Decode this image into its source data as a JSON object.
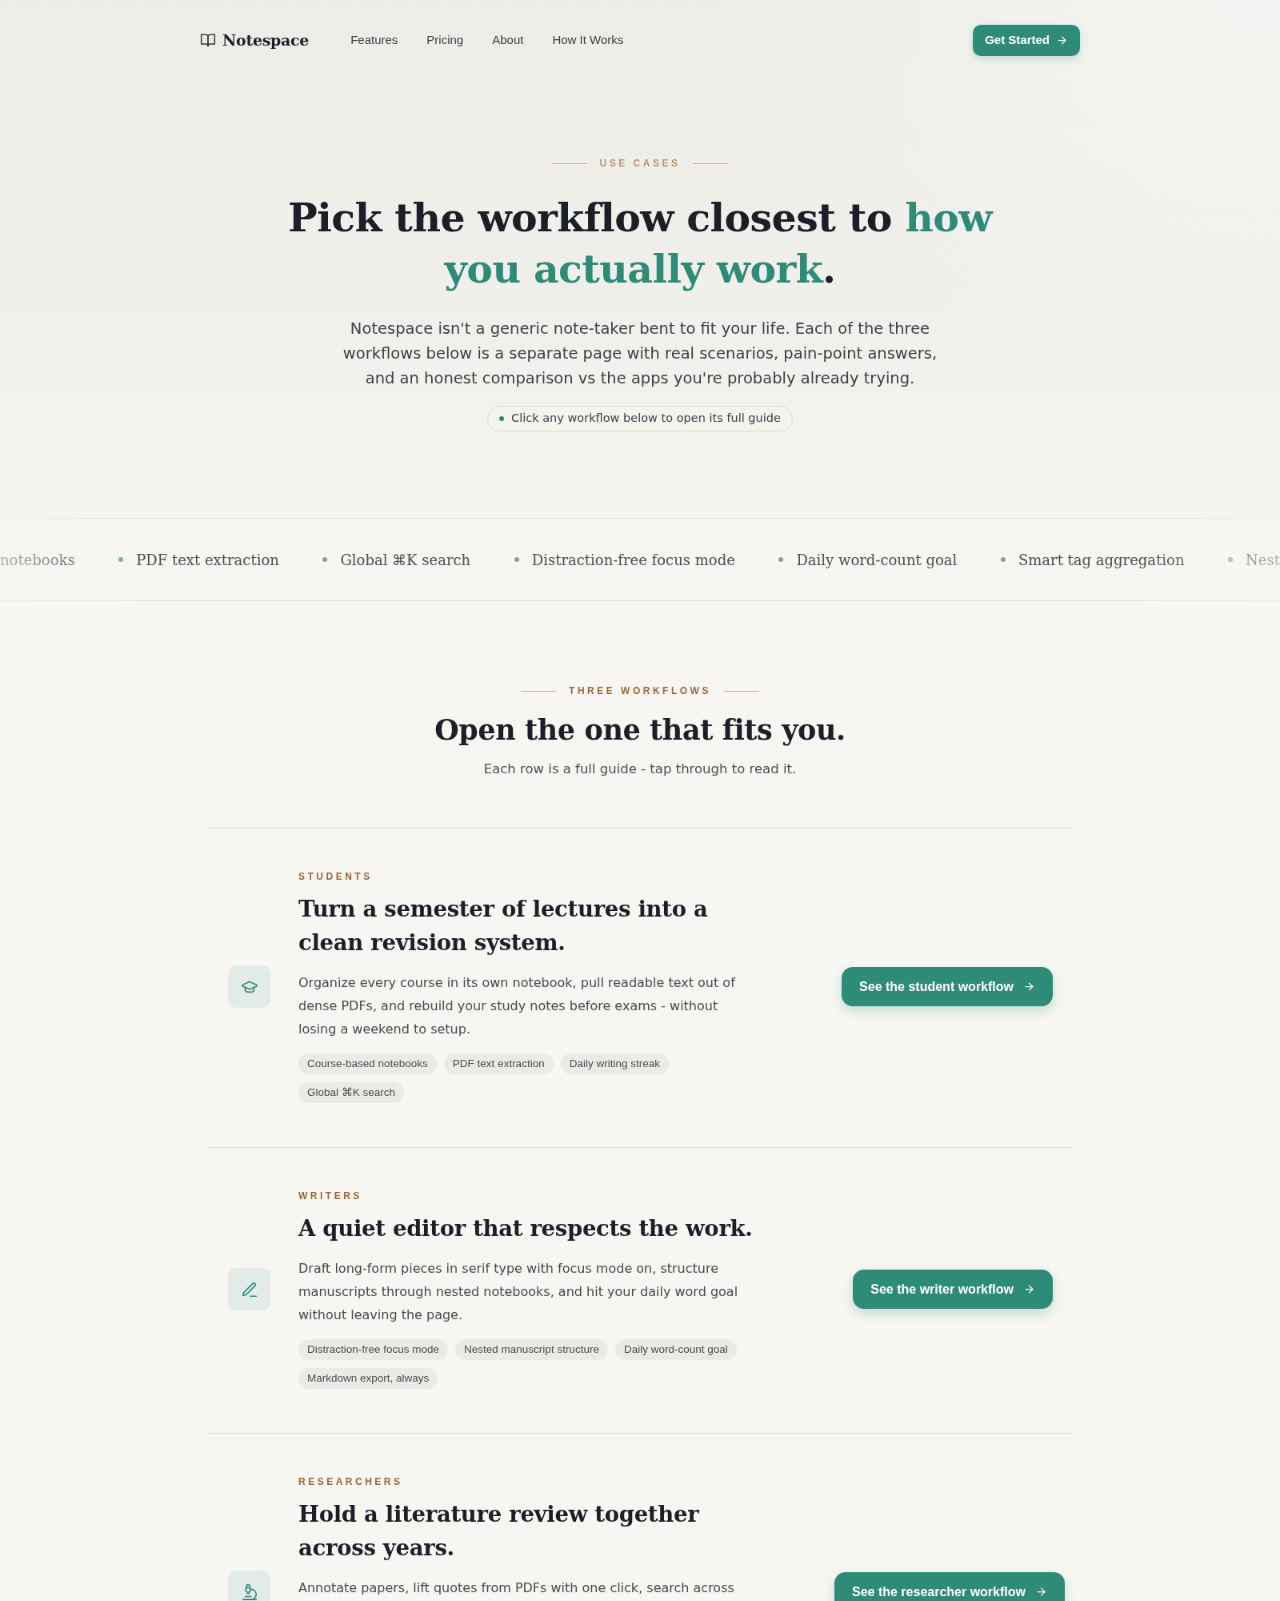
{
  "nav": {
    "brand": "Notespace",
    "links": [
      "Features",
      "Pricing",
      "About",
      "How It Works"
    ],
    "cta": "Get Started"
  },
  "hero": {
    "eyebrow": "USE CASES",
    "title": [
      {
        "text": "Pick the workflow closest to ",
        "accent": false
      },
      {
        "text": "how you actually work",
        "accent": true
      },
      {
        "text": ".",
        "accent": false
      }
    ],
    "intro": "Notespace isn't a generic note-taker bent to fit your life. Each of the three workflows below is a separate page with real scenarios, pain-point answers, and an honest comparison vs the apps you're probably already trying.",
    "hint": "Click any workflow below to open its full guide"
  },
  "marquee": [
    "notebooks",
    "PDF text extraction",
    "Global ⌘K search",
    "Distraction-free focus mode",
    "Daily word-count goal",
    "Smart tag aggregation",
    "Nest"
  ],
  "workflows": {
    "eyebrow": "THREE WORKFLOWS",
    "title": "Open the one that fits you.",
    "subtitle": "Each row is a full guide - tap through to read it.",
    "rows": [
      {
        "kind": "student",
        "eyebrow": "STUDENTS",
        "title": "Turn a semester of lectures into a clean revision system.",
        "description": "Organize every course in its own notebook, pull readable text out of dense PDFs, and rebuild your study notes before exams - without losing a weekend to setup.",
        "tags": [
          "Course-based notebooks",
          "PDF text extraction",
          "Daily writing streak",
          "Global ⌘K search"
        ],
        "button": "See the student workflow"
      },
      {
        "kind": "writer",
        "eyebrow": "WRITERS",
        "title": "A quiet editor that respects the work.",
        "description": "Draft long-form pieces in serif type with focus mode on, structure manuscripts through nested notebooks, and hit your daily word goal without leaving the page.",
        "tags": [
          "Distraction-free focus mode",
          "Nested manuscript structure",
          "Daily word-count goal",
          "Markdown export, always"
        ],
        "button": "See the writer workflow"
      },
      {
        "kind": "researcher",
        "eyebrow": "RESEARCHERS",
        "title": "Hold a literature review together across years.",
        "description": "Annotate papers, lift quotes from PDFs with one click, search across",
        "button": "See the researcher workflow"
      }
    ]
  }
}
